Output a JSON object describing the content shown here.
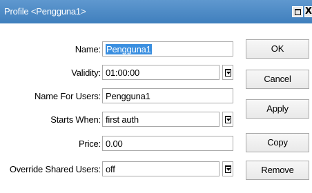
{
  "window": {
    "title": "Profile <Pengguna1>",
    "maximize_glyph": "",
    "close_glyph": "X"
  },
  "form": {
    "name": {
      "label": "Name:",
      "value": "Pengguna1"
    },
    "validity": {
      "label": "Validity:",
      "value": "01:00:00"
    },
    "name_for_users": {
      "label": "Name For Users:",
      "value": "Pengguna1"
    },
    "starts_when": {
      "label": "Starts When:",
      "value": "first auth"
    },
    "price": {
      "label": "Price:",
      "value": "0.00"
    },
    "override_shared_users": {
      "label": "Override Shared Users:",
      "value": "off"
    }
  },
  "buttons": {
    "ok": "OK",
    "cancel": "Cancel",
    "apply": "Apply",
    "copy": "Copy",
    "remove": "Remove"
  },
  "colors": {
    "titlebar": "#4a87c4",
    "selection": "#3a8fe0"
  }
}
